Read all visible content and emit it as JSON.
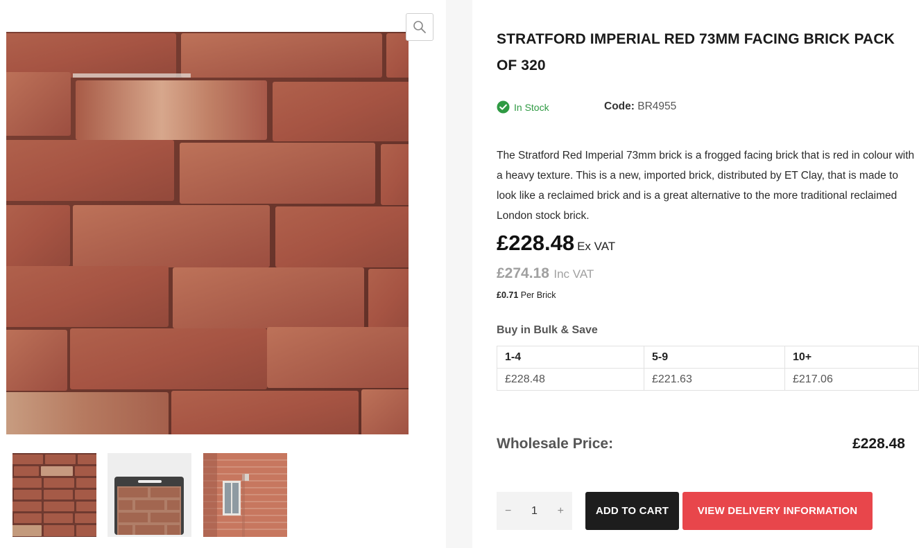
{
  "product": {
    "title": "STRATFORD IMPERIAL RED 73MM FACING BRICK PACK OF 320",
    "stock_status": "In Stock",
    "code_label": "Code:",
    "code_value": "BR4955",
    "description": "The Stratford Red Imperial 73mm brick is a frogged facing brick that is red in colour with a heavy texture. This is a new, imported brick, distributed by ET Clay, that is made to look like a reclaimed brick and is a great alternative to the more traditional reclaimed London stock brick."
  },
  "pricing": {
    "ex_vat_amount": "£228.48",
    "ex_vat_label": "Ex VAT",
    "inc_vat_amount": "£274.18",
    "inc_vat_label": "Inc VAT",
    "per_brick_amount": "£0.71",
    "per_brick_label": "Per Brick"
  },
  "bulk": {
    "title": "Buy in Bulk & Save",
    "headers": [
      "1-4",
      "5-9",
      "10+"
    ],
    "prices": [
      "£228.48",
      "£221.63",
      "£217.06"
    ]
  },
  "wholesale": {
    "label": "Wholesale Price:",
    "value": "£228.48"
  },
  "cart": {
    "minus": "−",
    "quantity": "1",
    "plus": "+",
    "add_to_cart_label": "ADD TO CART",
    "delivery_label": "VIEW DELIVERY INFORMATION"
  },
  "gallery": {
    "zoom_icon": "search-icon",
    "thumbnails": [
      "brick-wall-closeup",
      "brick-sample-board",
      "brick-house-wall"
    ]
  },
  "colors": {
    "in_stock": "#2f9a43",
    "cart_button": "#1d1d1d",
    "delivery_button": "#e8464b",
    "muted_price": "#a0a0a0"
  }
}
